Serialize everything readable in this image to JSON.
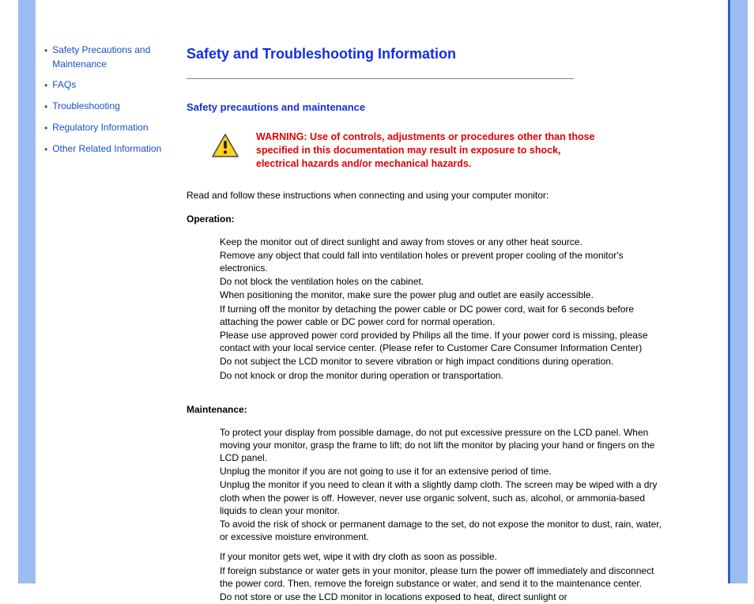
{
  "sidebar": {
    "items": [
      {
        "label": "Safety Precautions and Maintenance"
      },
      {
        "label": "FAQs"
      },
      {
        "label": "Troubleshooting"
      },
      {
        "label": "Regulatory Information"
      },
      {
        "label": "Other Related Information"
      }
    ]
  },
  "main": {
    "title": "Safety and Troubleshooting Information",
    "section_heading": "Safety precautions and maintenance",
    "warning": "WARNING: Use of controls, adjustments or procedures other than those specified in this documentation may result in exposure to shock, electrical hazards and/or mechanical hazards.",
    "intro": "Read and follow these instructions when connecting and using your computer monitor:",
    "operation_label": "Operation:",
    "operation_items": [
      "Keep the monitor out of direct sunlight and away from stoves or any other heat source.",
      "Remove any object that could fall into ventilation holes or prevent proper cooling of the monitor's electronics.",
      "Do not block the ventilation holes on the cabinet.",
      "When positioning the monitor, make sure the power plug and outlet are easily accessible.",
      "If turning off the monitor by detaching the power cable or DC power cord, wait for 6 seconds before attaching the power cable or DC power cord for normal operation.",
      "Please use approved power cord provided by Philips all the time. If your power cord is missing, please contact with your local service center. (Please refer to Customer Care Consumer Information Center)",
      "Do not subject the LCD monitor to severe vibration or high impact conditions during operation.",
      "Do not knock or drop the monitor during operation or transportation."
    ],
    "maintenance_label": "Maintenance:",
    "maintenance_items": [
      "To protect your display from possible damage, do not put excessive pressure on the LCD panel. When moving your monitor, grasp the frame to lift; do not lift the monitor by placing your hand or fingers on the LCD panel.",
      "Unplug the monitor if you are not going to use it for an extensive period of time.",
      "Unplug the monitor if you need to clean it with a slightly damp cloth. The screen may be wiped with a dry cloth when the power is off. However, never use organic solvent, such as, alcohol, or ammonia-based liquids to clean your monitor.",
      "To avoid the risk of shock or permanent damage to the set, do not expose the monitor to dust, rain, water, or excessive moisture environment."
    ],
    "maintenance_items_b": [
      "If your monitor gets wet, wipe it with dry cloth as soon as possible.",
      "If foreign substance or water gets in your monitor, please turn the power off immediately and disconnect the power cord. Then, remove the foreign substance or water, and send it to the maintenance center.",
      "Do not store or use the LCD monitor in locations exposed to heat, direct sunlight or"
    ]
  }
}
